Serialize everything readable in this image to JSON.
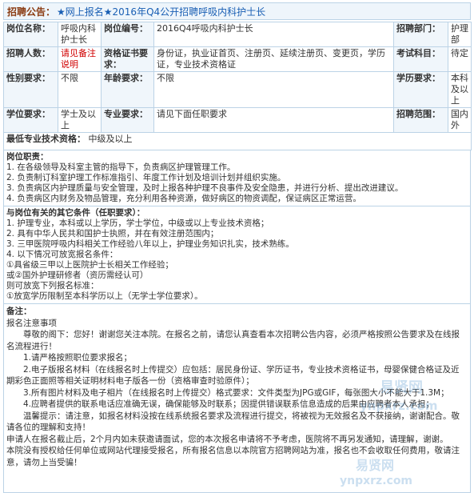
{
  "header": {
    "label": "招聘公告：",
    "link": "★网上报名★2016年Q4公开招聘呼吸内科护士长"
  },
  "info": {
    "position_name_label": "岗位名称：",
    "position_name_value": "呼吸内科护士长",
    "position_code_label": "岗位编号：",
    "position_code_value": "2016Q4呼吸内科护士长",
    "dept_label": "招聘部门：",
    "dept_value": "护理部",
    "count_label": "招聘人数：",
    "count_value": "请见备注说明",
    "cert_label": "资格证书要求：",
    "cert_value": "身份证，执业证首页、注册页、延续注册页、变更页，学历证，专业技术资格证",
    "exam_label": "考试科目：",
    "exam_value": "待定",
    "gender_label": "性别要求：",
    "gender_value": "不限",
    "age_label": "年龄要求：",
    "age_value": "不限",
    "edu_label": "学历要求：",
    "edu_value": "本科及以上",
    "degree_label": "学位要求：",
    "degree_value": "学士及以上",
    "major_label": "专业要求：",
    "major_value": "请见下面任职要求",
    "scope_label": "招聘范围：",
    "scope_value": "国内外",
    "tech_label": "最低专业技术资格：",
    "tech_value": "中级及以上"
  },
  "duties": {
    "title": "岗位职责：",
    "items": [
      "1. 在各级领导及科室主管的指导下，负责病区护理管理工作。",
      "2. 负责制订科室护理工作标准指引、年度工作计划及培训计划并组织实施。",
      "3. 负责病区内护理质量与安全管理，及时上报各种护理不良事件及安全隐患，并进行分析、提出改进建议。",
      "4. 负责病区内财务及物品管理，充分利用各种资源，做好病区的物资调配，保证病区正常运营。"
    ]
  },
  "requirements": {
    "title": "与岗位有关的其它条件（任职要求）：",
    "items": [
      "1. 护理专业，本科或以上学历，学士学位，中级或以上专业技术资格；",
      "2. 具有中华人民共和国护士执照，并在有效注册范围内；",
      "3. 三甲医院呼吸内科相关工作经验八年以上，护理业务知识扎实，技术熟练。",
      "4. 以下情况可放宽报名条件：",
      "①具省级三甲以上医院护士长相关工作经验；",
      "或②国外护理研修者（资历需经认可）",
      "则可放宽下列报名标准：",
      "①放宽学历限制至本科学历以上（无学士学位要求）。"
    ]
  },
  "notes": {
    "title": "备注：",
    "lines": [
      "报名注意事项",
      "尊敬的阁下：您好！谢谢您关注本院。在报名之前，请您认真查看本次招聘公告内容，必须严格按照公告要求及在线报名流程进行！",
      "1.请严格按照职位要求报名；",
      "2.电子版报名材料（在线报名时上传提交）应包括：居民身份证、学历证书，专业技术资格证书，母婴保健合格证及近期彩色正面照等相关证明材料电子版各一份（资格审查时验原件）；",
      "3.所有图片材料及电子相片（在线报名时上传提交）格式要求：文件类型为JPG或GIF，每张图大小不能大于1.3M；",
      "4.应聘者提供的联系电话应准确无误，确保能够及时联系；因提供错误联系信息造成的后果由应聘者本人承担；",
      "温馨提示：请注意，如报名材料没按在线系统报名要求及流程进行提交，将被视为无效报名及不获接纳，谢谢配合。敬请各位的理解和支持！",
      "申请人在报名截止后，2个月内如未获邀请面试，您的本次报名申请将不予考虑，医院将不再另发通知，请理解，谢谢。",
      "本院没有授权给任何单位或网站代理接受报名，所有报名信息以本院官方招聘网站为准，报名也不会收取任何费用，敬请注意，请勿上当受骗！"
    ]
  },
  "watermarks": [
    "易贤网",
    "ynpxrz.com"
  ]
}
